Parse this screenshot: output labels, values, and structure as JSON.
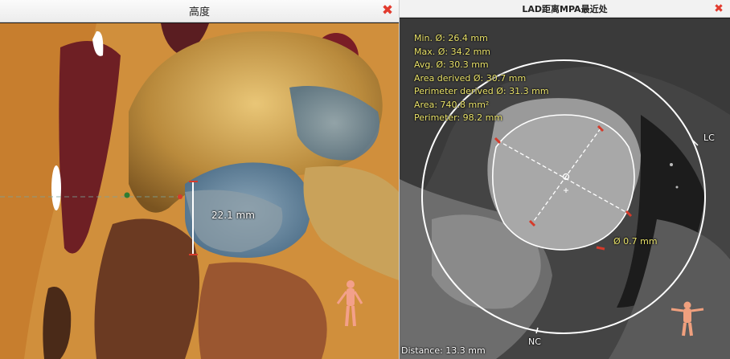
{
  "left_panel": {
    "title": "高度",
    "measurement_label": "22.1 mm"
  },
  "right_panel": {
    "title": "LAD距离MPA最近处",
    "stats": [
      "Min. Ø: 26.4 mm",
      "Max. Ø: 34.2 mm",
      "Avg. Ø: 30.3 mm",
      "Area derived Ø: 30.7 mm",
      "Perimeter derived Ø: 31.3 mm",
      "Area: 740.8 mm²",
      "Perimeter: 98.2 mm"
    ],
    "lc_label": "LC",
    "nc_label": "NC",
    "offset_label": "Ø 0.7 mm",
    "distance_label": "Distance: 13.3 mm"
  },
  "colors": {
    "close_icon": "#e23b2e",
    "stats_text": "#e9e26a",
    "measure_marker": "#d63a2a"
  }
}
